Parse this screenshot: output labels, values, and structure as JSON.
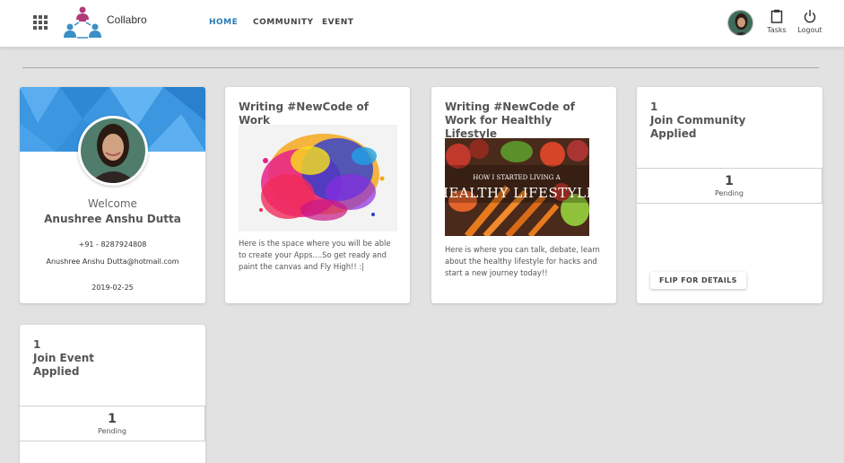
{
  "header": {
    "brand": "Collabro",
    "nav": [
      {
        "label": "HOME",
        "active": true
      },
      {
        "label": "COMMUNITY",
        "active": false
      },
      {
        "label": "EVENT",
        "active": false
      }
    ],
    "actions": {
      "tasks": "Tasks",
      "logout": "Logout"
    }
  },
  "profile": {
    "welcome": "Welcome",
    "name": "Anushree Anshu Dutta",
    "phone": "+91 - 8287924808",
    "email": "Anushree Anshu Dutta@hotmail.com",
    "date": "2019-02-25"
  },
  "cards": [
    {
      "title": "Writing #NewCode of Work",
      "text": "Here is the space where you will be able to create your Apps....So get ready and paint the canvas and Fly High!! :|"
    },
    {
      "title": "Writing #NewCode of Work for Healthly Lifestyle",
      "image_text_top": "HOW I STARTED LIVING A",
      "image_text_main": "HEALTHY LIFESTYLE",
      "text": "Here is where you can talk, debate, learn about the healthy lifestyle for hacks and start a new journey today!!"
    }
  ],
  "community_card": {
    "count": "1",
    "line1": "Join Community",
    "line2": "Applied",
    "pending_count": "1",
    "pending_label": "Pending",
    "button": "FLIP FOR DETAILS"
  },
  "event_card": {
    "count": "1",
    "line1": "Join Event",
    "line2": "Applied",
    "pending_count": "1",
    "pending_label": "Pending"
  },
  "colors": {
    "accent": "#2a7ab8",
    "background": "#e2e2e2",
    "banner": "#3c97e0"
  }
}
